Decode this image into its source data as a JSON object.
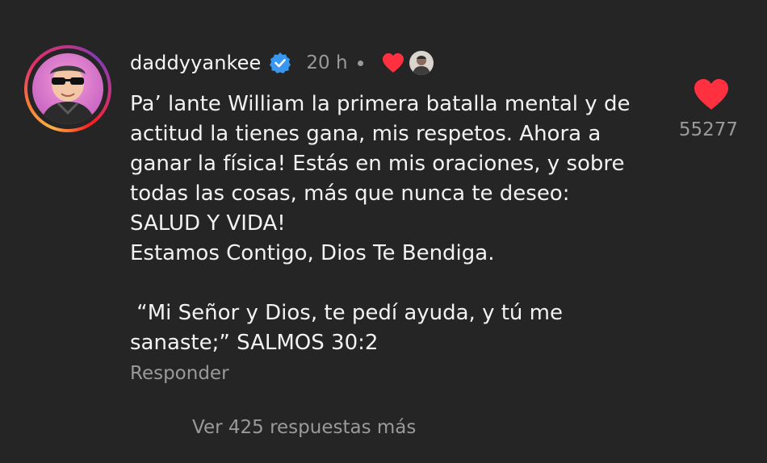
{
  "comment": {
    "avatar_icon": "user-avatar-image",
    "username": "daddyyankee",
    "verified_icon": "verified-badge-icon",
    "timestamp": "20 h",
    "creator_liked_icon": "heart-icon",
    "creator_avatar_icon": "creator-avatar-image",
    "lines": [
      "Pa’ lante William la primera batalla mental y de",
      "actitud la tienes gana, mis respetos. Ahora a",
      "ganar la física! Estás en mis oraciones, y sobre",
      "todas las cosas, más que nunca te deseo:",
      "SALUD Y VIDA!",
      "Estamos Contigo, Dios Te Bendiga.",
      "",
      " “Mi Señor y Dios, te pedí ayuda, y tú me",
      "sanaste;” SALMOS 30:2"
    ],
    "reply_label": "Responder",
    "like_icon": "heart-icon",
    "like_count": "55277"
  },
  "more_replies_label": "Ver 425 respuestas más",
  "colors": {
    "background": "#252525",
    "text": "#f2f2f2",
    "muted": "#9a9a9a",
    "heart": "#ff3040",
    "verified": "#3897f0"
  }
}
